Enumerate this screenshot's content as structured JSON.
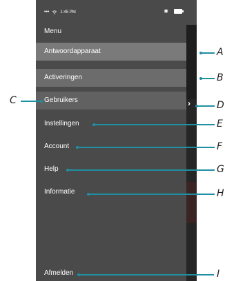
{
  "status_bar": {
    "dots": "•••",
    "time": "1:45 PM"
  },
  "menu": {
    "title": "Menu",
    "items": [
      {
        "label": "Antwoordapparaat"
      },
      {
        "label": "Activeringen"
      },
      {
        "label": "Gebruikers"
      },
      {
        "label": "Instellingen"
      },
      {
        "label": "Account"
      },
      {
        "label": "Help"
      },
      {
        "label": "Informatie"
      },
      {
        "label": "Afmelden"
      }
    ],
    "chevron": "›"
  },
  "callouts": {
    "A": "A",
    "B": "B",
    "C": "C",
    "D": "D",
    "E": "E",
    "F": "F",
    "G": "G",
    "H": "H",
    "I": "I"
  },
  "colors": {
    "callout": "#1f8fa3",
    "menu_bg": "#4a4a4a",
    "highlight": "#7a7a7a"
  }
}
